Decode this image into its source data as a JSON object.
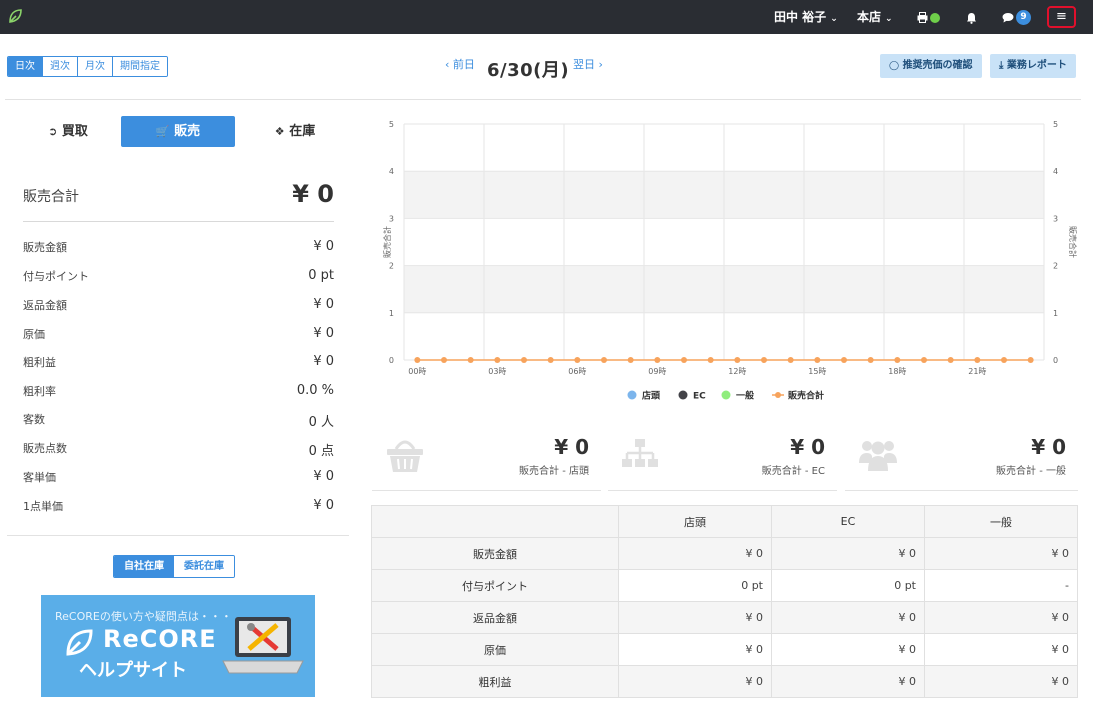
{
  "topbar": {
    "user": "田中 裕子",
    "store": "本店",
    "notifications_count": "9"
  },
  "period_tabs": [
    "日次",
    "週次",
    "月次",
    "期間指定"
  ],
  "date_nav": {
    "prev": "前日",
    "current": "6/30(月)",
    "next": "翌日"
  },
  "actions": {
    "recommend": "推奨売価の確認",
    "report": "業務レポート"
  },
  "left_tabs": [
    "買取",
    "販売",
    "在庫"
  ],
  "summary": {
    "label": "販売合計",
    "value": "¥ 0",
    "rows": [
      {
        "k": "販売金額",
        "v": "¥ 0"
      },
      {
        "k": "付与ポイント",
        "v": "0 pt"
      },
      {
        "k": "返品金額",
        "v": "¥ 0"
      },
      {
        "k": "原価",
        "v": "¥ 0"
      },
      {
        "k": "粗利益",
        "v": "¥ 0"
      },
      {
        "k": "粗利率",
        "v": "0.0 %"
      },
      {
        "k": "客数",
        "v": "0 人"
      },
      {
        "k": "販売点数",
        "v": "0 点"
      },
      {
        "k": "客単価",
        "v": "¥ 0"
      },
      {
        "k": "1点単価",
        "v": "¥ 0"
      }
    ]
  },
  "stock_toggle": [
    "自社在庫",
    "委託在庫"
  ],
  "banner": {
    "sub": "ReCOREの使い方や疑問点は・・・",
    "brand": "ReCORE",
    "help": "ヘルプサイト"
  },
  "chart_data": {
    "type": "line",
    "x": [
      "00時",
      "01時",
      "02時",
      "03時",
      "04時",
      "05時",
      "06時",
      "07時",
      "08時",
      "09時",
      "10時",
      "11時",
      "12時",
      "13時",
      "14時",
      "15時",
      "16時",
      "17時",
      "18時",
      "19時",
      "20時",
      "21時",
      "22時",
      "23時"
    ],
    "x_tick_labels": [
      "00時",
      "03時",
      "06時",
      "09時",
      "12時",
      "15時",
      "18時",
      "21時"
    ],
    "ylim": [
      0,
      5
    ],
    "y_ticks": [
      "0",
      "1",
      "2",
      "3",
      "4",
      "5"
    ],
    "ylabel_left": "販売合計",
    "ylabel_right": "販売合計",
    "legend": [
      "店頭",
      "EC",
      "一般",
      "販売合計"
    ],
    "legend_colors": [
      "#7cb5ec",
      "#434348",
      "#90ed7d",
      "#f7a35c"
    ],
    "series": [
      {
        "name": "販売合計",
        "values": [
          0,
          0,
          0,
          0,
          0,
          0,
          0,
          0,
          0,
          0,
          0,
          0,
          0,
          0,
          0,
          0,
          0,
          0,
          0,
          0,
          0,
          0,
          0,
          0
        ]
      }
    ]
  },
  "cards": [
    {
      "value": "¥ 0",
      "label": "販売合計 - 店頭",
      "icon": "basket-icon"
    },
    {
      "value": "¥ 0",
      "label": "販売合計 - EC",
      "icon": "sitemap-icon"
    },
    {
      "value": "¥ 0",
      "label": "販売合計 - 一般",
      "icon": "users-icon"
    }
  ],
  "table": {
    "headers": [
      "",
      "店頭",
      "EC",
      "一般"
    ],
    "rows": [
      [
        "販売金額",
        "¥ 0",
        "¥ 0",
        "¥ 0"
      ],
      [
        "付与ポイント",
        "0 pt",
        "0 pt",
        "-"
      ],
      [
        "返品金額",
        "¥ 0",
        "¥ 0",
        "¥ 0"
      ],
      [
        "原価",
        "¥ 0",
        "¥ 0",
        "¥ 0"
      ],
      [
        "粗利益",
        "¥ 0",
        "¥ 0",
        "¥ 0"
      ]
    ]
  }
}
